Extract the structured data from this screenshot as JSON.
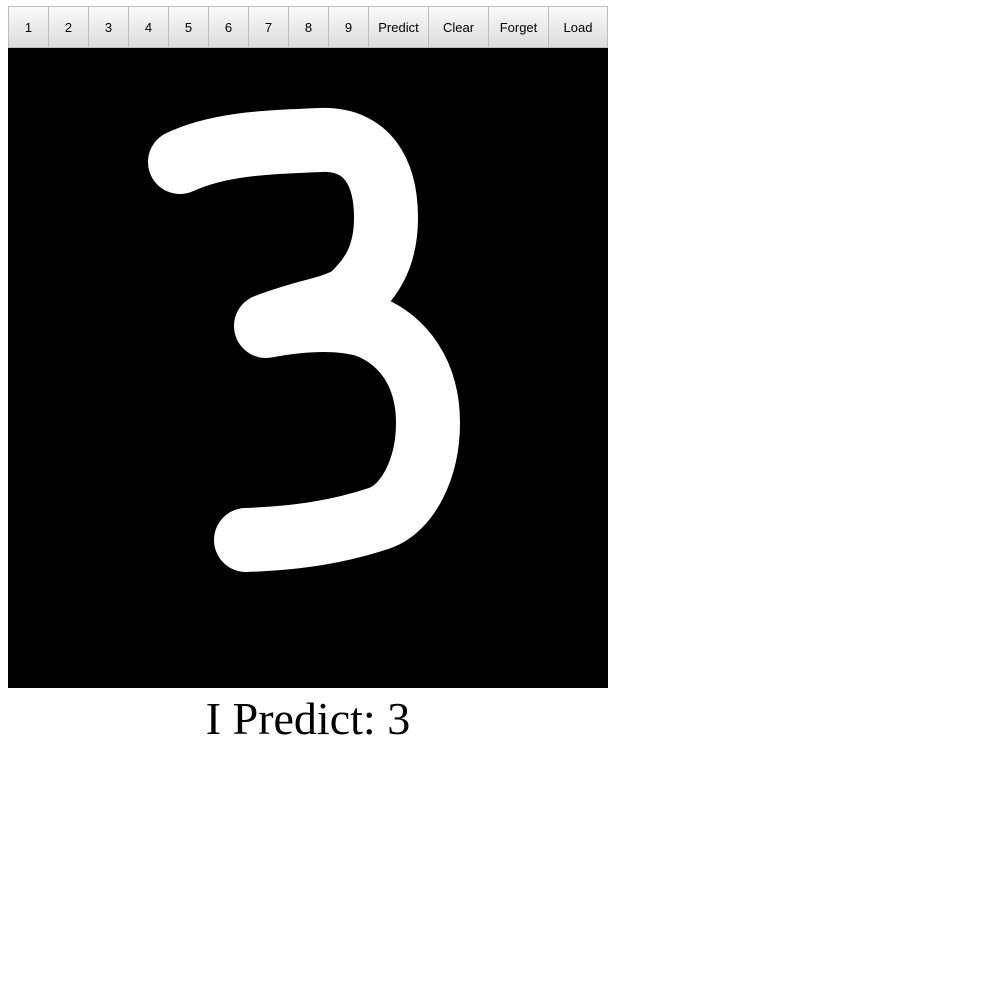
{
  "toolbar": {
    "digits": [
      "1",
      "2",
      "3",
      "4",
      "5",
      "6",
      "7",
      "8",
      "9"
    ],
    "predict_label": "Predict",
    "clear_label": "Clear",
    "forget_label": "Forget",
    "load_label": "Load"
  },
  "canvas": {
    "background": "#000000",
    "stroke_color": "#ffffff"
  },
  "prediction": {
    "text": "I Predict: 3"
  }
}
